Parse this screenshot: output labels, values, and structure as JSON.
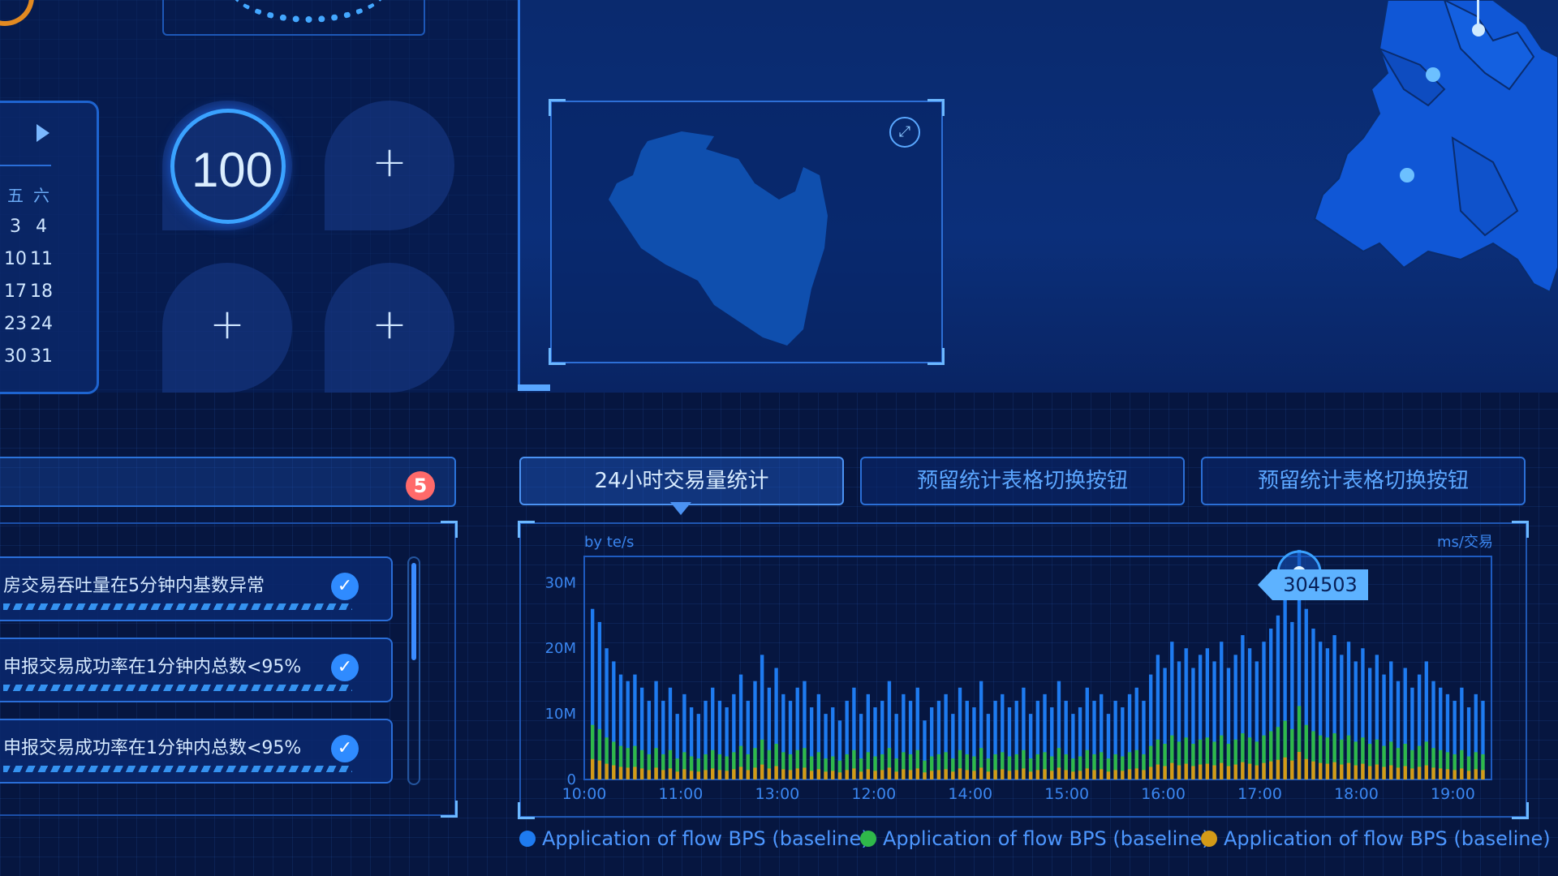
{
  "score": {
    "value": "100"
  },
  "calendar": {
    "weekday_fri": "五",
    "weekday_sat": "六",
    "rows": [
      [
        "3",
        "4"
      ],
      [
        "10",
        "11"
      ],
      [
        "17",
        "18"
      ],
      [
        "23",
        "24"
      ],
      [
        "30",
        "31"
      ]
    ]
  },
  "alerts": {
    "count": "5",
    "items": [
      {
        "text": "房交易吞吐量在5分钟内基数异常"
      },
      {
        "text": "申报交易成功率在1分钟内总数<95%"
      },
      {
        "text": "申报交易成功率在1分钟内总数<95%"
      }
    ]
  },
  "tabs": [
    {
      "label": "24小时交易量统计"
    },
    {
      "label": "预留统计表格切换按钮"
    },
    {
      "label": "预留统计表格切换按钮"
    }
  ],
  "chart_data": {
    "type": "bar",
    "y_unit_left": "by te/s",
    "y_unit_right": "ms/交易",
    "y_ticks": [
      "30M",
      "20M",
      "10M",
      "0"
    ],
    "ylim": [
      0,
      30000000
    ],
    "x_ticks": [
      "10:00",
      "11:00",
      "13:00",
      "12:00",
      "14:00",
      "15:00",
      "16:00",
      "17:00",
      "18:00",
      "19:00"
    ],
    "highlight_value": "304503",
    "series": [
      {
        "name": "Application of flow BPS (baseline)",
        "color": "#1e7bf0"
      },
      {
        "name": "Application of flow BPS (baseline)",
        "color": "#2fb84a"
      },
      {
        "name": "Application of flow BPS (baseline)",
        "color": "#d39a18"
      }
    ],
    "values": [
      26,
      24,
      20,
      18,
      16,
      15,
      16,
      14,
      12,
      15,
      12,
      14,
      10,
      13,
      11,
      10,
      12,
      14,
      12,
      11,
      13,
      16,
      12,
      15,
      19,
      14,
      17,
      13,
      12,
      14,
      15,
      11,
      13,
      10,
      11,
      9,
      12,
      14,
      10,
      13,
      11,
      12,
      15,
      10,
      13,
      12,
      14,
      9,
      11,
      12,
      13,
      10,
      14,
      12,
      11,
      15,
      10,
      12,
      13,
      11,
      12,
      14,
      10,
      12,
      13,
      11,
      15,
      12,
      10,
      11,
      14,
      12,
      13,
      10,
      12,
      11,
      13,
      14,
      12,
      16,
      19,
      17,
      21,
      18,
      20,
      17,
      19,
      20,
      18,
      21,
      17,
      19,
      22,
      20,
      18,
      21,
      23,
      25,
      28,
      24,
      35,
      26,
      23,
      21,
      20,
      22,
      19,
      21,
      18,
      20,
      17,
      19,
      16,
      18,
      15,
      17,
      14,
      16,
      18,
      15,
      14,
      13,
      12,
      14,
      11,
      13,
      12
    ]
  }
}
